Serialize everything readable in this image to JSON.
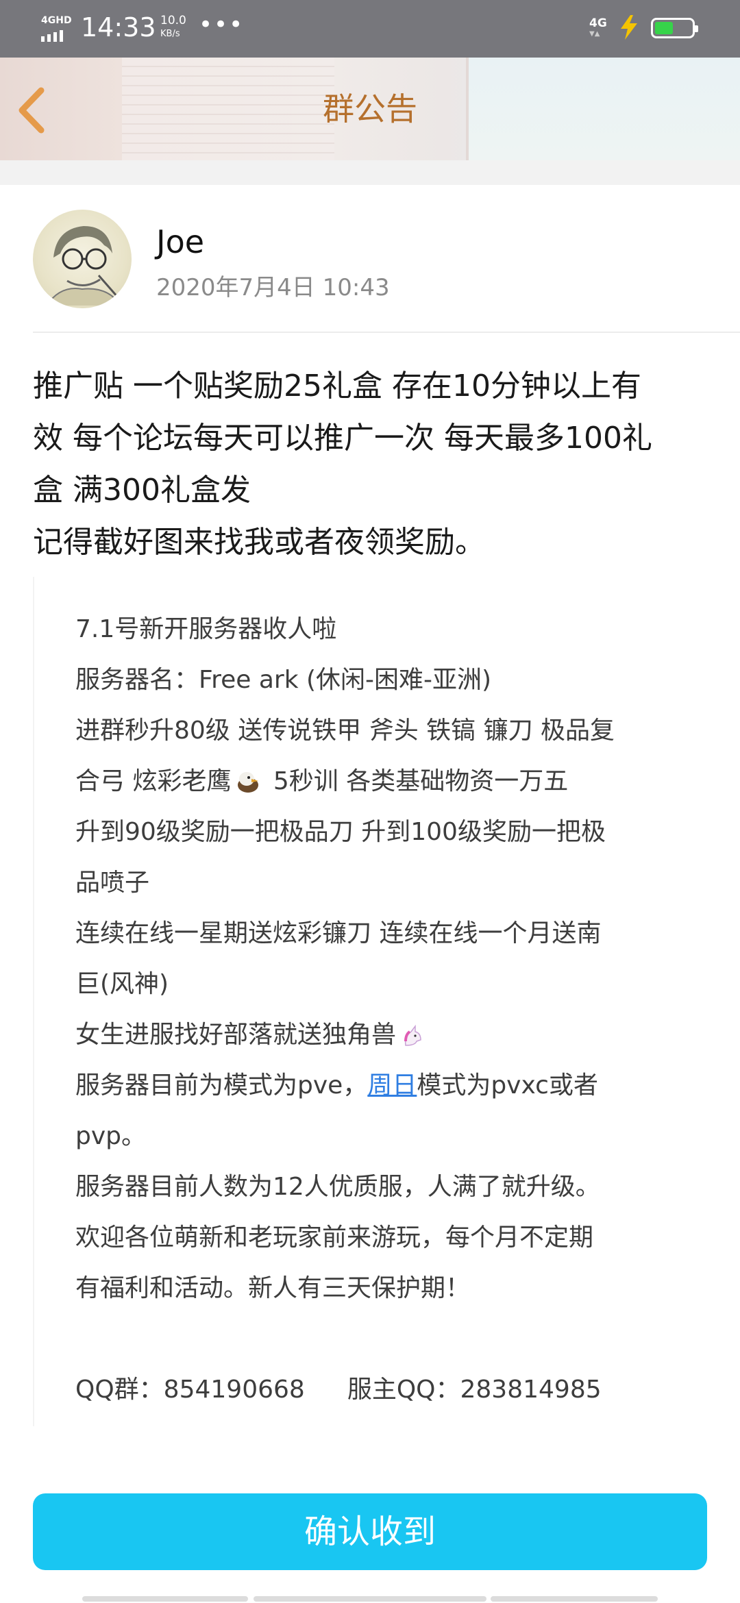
{
  "status_bar": {
    "network": "4GHD",
    "time": "14:33",
    "speed_value": "10.0",
    "speed_unit": "KB/s",
    "more": "•••",
    "cell": "4G",
    "battery_color": "#37d34a"
  },
  "header": {
    "title": "群公告",
    "back_icon": "chevron-left-icon",
    "title_color": "#b5702d"
  },
  "post": {
    "author": "Joe",
    "time": "2020年7月4日 10:43",
    "body_lines": [
      "推广贴 一个贴奖励25礼盒 存在10分钟以上有",
      "效 每个论坛每天可以推广一次 每天最多100礼",
      "盒 满300礼盒发",
      "记得截好图来找我或者夜领奖励。"
    ]
  },
  "image_text": {
    "l1": "7.1号新开服务器收人啦",
    "l2": "服务器名：Free ark (休闲-困难-亚洲)",
    "l3": "进群秒升80级 送传说铁甲 斧头 铁镐 镰刀 极品复",
    "l4a": "合弓 炫彩老鹰",
    "l4b": " 5秒训 各类基础物资一万五",
    "l5": "升到90级奖励一把极品刀 升到100级奖励一把极",
    "l6": "品喷子",
    "l7": "连续在线一星期送炫彩镰刀 连续在线一个月送南",
    "l8": "巨(风神)",
    "l9": "女生进服找好部落就送独角兽",
    "l10a": "服务器目前为模式为pve，",
    "l10link": "周日",
    "l10b": "模式为pvxc或者",
    "l11": "pvp。",
    "l12": "服务器目前人数为12人优质服，人满了就升级。",
    "l13": "欢迎各位萌新和老玩家前来游玩，每个月不定期",
    "l14": "有福利和活动。新人有三天保护期！",
    "qq_group": "QQ群：854190668",
    "owner_qq": "服主QQ：283814985",
    "eagle_icon": "eagle-emoji-icon",
    "unicorn_icon": "unicorn-emoji-icon"
  },
  "actions": {
    "confirm": "确认收到",
    "confirm_color": "#19c6f2"
  }
}
